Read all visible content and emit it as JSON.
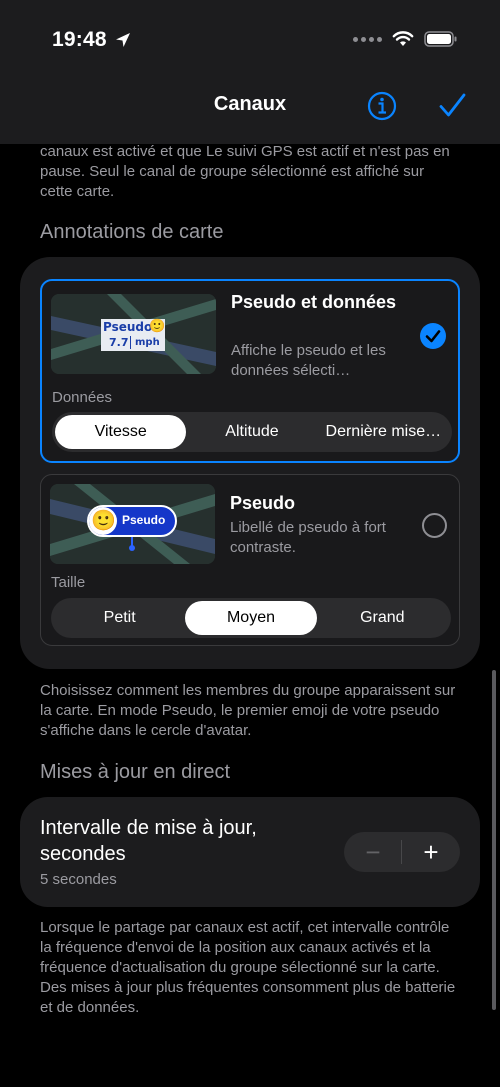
{
  "status": {
    "time": "19:48"
  },
  "nav": {
    "title": "Canaux"
  },
  "intro_text": "canaux est activé et que Le suivi GPS est actif et n'est pas en pause. Seul le canal de groupe sélectionné est affiché sur cette carte.",
  "annotations": {
    "header": "Annotations de carte",
    "options": [
      {
        "title": "Pseudo et données",
        "description": "Affiche le pseudo et les données sélecti…",
        "selected": true,
        "thumbnail": {
          "name": "Pseudo",
          "emoji": "🙂",
          "speed": "7.7",
          "unit": "mph"
        },
        "segment_label": "Données",
        "segments": [
          "Vitesse",
          "Altitude",
          "Dernière mise…"
        ],
        "active_segment": "Vitesse"
      },
      {
        "title": "Pseudo",
        "description": "Libellé de pseudo à fort contraste.",
        "selected": false,
        "thumbnail": {
          "name": "Pseudo",
          "emoji": "🙂"
        },
        "segment_label": "Taille",
        "segments": [
          "Petit",
          "Moyen",
          "Grand"
        ],
        "active_segment": "Moyen"
      }
    ],
    "footer": "Choisissez comment les membres du groupe apparaissent sur la carte. En mode Pseudo, le premier emoji de votre pseudo s'affiche dans le cercle d'avatar."
  },
  "live_updates": {
    "header": "Mises à jour en direct",
    "interval_title": "Intervalle de mise à jour, secondes",
    "interval_value": "5 secondes",
    "stepper": {
      "minus": "−",
      "plus": "+"
    },
    "footer": "Lorsque le partage par canaux est actif, cet intervalle contrôle la fréquence d'envoi de la position aux canaux activés et la fréquence d'actualisation du groupe sélectionné sur la carte. Des mises à jour plus fréquentes consomment plus de batterie et de données."
  },
  "colors": {
    "accent": "#0a84ff",
    "background": "#000000",
    "card": "#1c1c1e",
    "secondary_text": "#9b9ba1"
  }
}
